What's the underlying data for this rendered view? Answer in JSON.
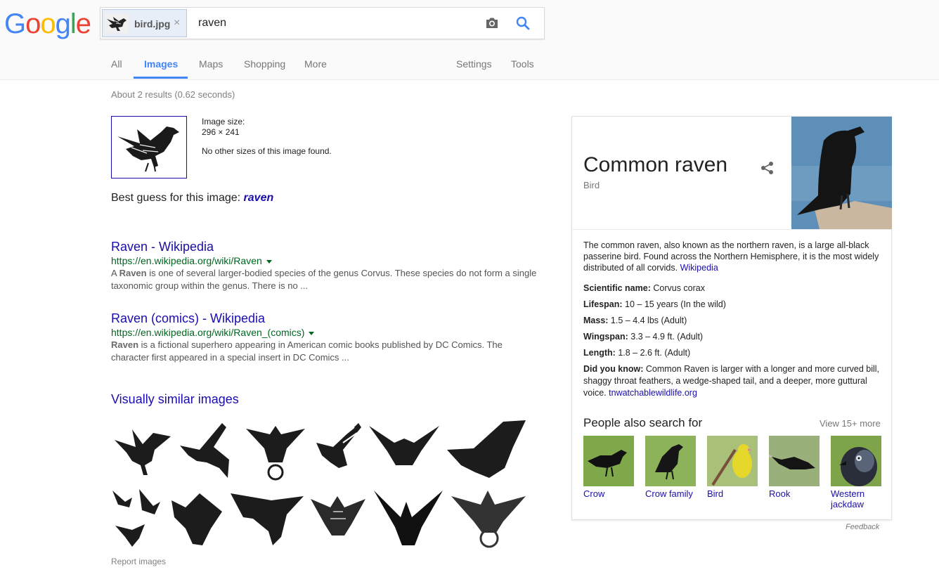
{
  "header": {
    "logo_letters": [
      {
        "ch": "G",
        "color": "#4285f4"
      },
      {
        "ch": "o",
        "color": "#ea4335"
      },
      {
        "ch": "o",
        "color": "#fbbc05"
      },
      {
        "ch": "g",
        "color": "#4285f4"
      },
      {
        "ch": "l",
        "color": "#34a853"
      },
      {
        "ch": "e",
        "color": "#ea4335"
      }
    ],
    "image_chip": {
      "filename": "bird.jpg",
      "close": "×"
    },
    "query": "raven",
    "camera_icon": "camera-icon",
    "search_icon": "search-icon"
  },
  "tabs": [
    {
      "label": "All",
      "active": false
    },
    {
      "label": "Images",
      "active": true
    },
    {
      "label": "Maps",
      "active": false
    },
    {
      "label": "Shopping",
      "active": false
    },
    {
      "label": "More",
      "active": false
    },
    {
      "label": "Settings",
      "active": false
    },
    {
      "label": "Tools",
      "active": false
    }
  ],
  "stats": "About 2 results (0.62 seconds)",
  "image_info": {
    "size_label": "Image size:",
    "size_value": "296 × 241",
    "other_sizes": "No other sizes of this image found."
  },
  "best_guess": {
    "prefix": "Best guess for this image:",
    "value": "raven"
  },
  "results": [
    {
      "title": "Raven - Wikipedia",
      "url": "https://en.wikipedia.org/wiki/Raven",
      "snippet_bold": "Raven",
      "snippet_pre": "A ",
      "snippet_post": " is one of several larger-bodied species of the genus Corvus. These species do not form a single taxonomic group within the genus. There is no ..."
    },
    {
      "title": "Raven (comics) - Wikipedia",
      "url": "https://en.wikipedia.org/wiki/Raven_(comics)",
      "snippet_bold": "Raven",
      "snippet_pre": "",
      "snippet_post": " is a fictional superhero appearing in American comic books published by DC Comics. The character first appeared in a special insert in DC Comics ..."
    }
  ],
  "visually_similar": {
    "title": "Visually similar images",
    "report": "Report images"
  },
  "knowledge_panel": {
    "title": "Common raven",
    "subtitle": "Bird",
    "share_icon": "share-icon",
    "description": "The common raven, also known as the northern raven, is a large all-black passerine bird. Found across the Northern Hemisphere, it is the most widely distributed of all corvids.",
    "description_source": "Wikipedia",
    "facts": [
      {
        "label": "Scientific name:",
        "value": "Corvus corax"
      },
      {
        "label": "Lifespan:",
        "value": "10 – 15 years (In the wild)"
      },
      {
        "label": "Mass:",
        "value": "1.5 – 4.4 lbs (Adult)"
      },
      {
        "label": "Wingspan:",
        "value": "3.3 – 4.9 ft. (Adult)"
      },
      {
        "label": "Length:",
        "value": "1.8 – 2.6 ft. (Adult)"
      }
    ],
    "did_you_know": {
      "label": "Did you know:",
      "value": "Common Raven is larger with a longer and more curved bill, shaggy throat feathers, a wedge-shaped tail, and a deeper, more guttural voice.",
      "source": "tnwatchablewildlife.org"
    },
    "people_also_search": {
      "title": "People also search for",
      "view_more": "View 15+ more",
      "items": [
        {
          "label": "Crow"
        },
        {
          "label": "Crow family"
        },
        {
          "label": "Bird"
        },
        {
          "label": "Rook"
        },
        {
          "label": "Western jackdaw"
        }
      ]
    },
    "feedback": "Feedback"
  }
}
